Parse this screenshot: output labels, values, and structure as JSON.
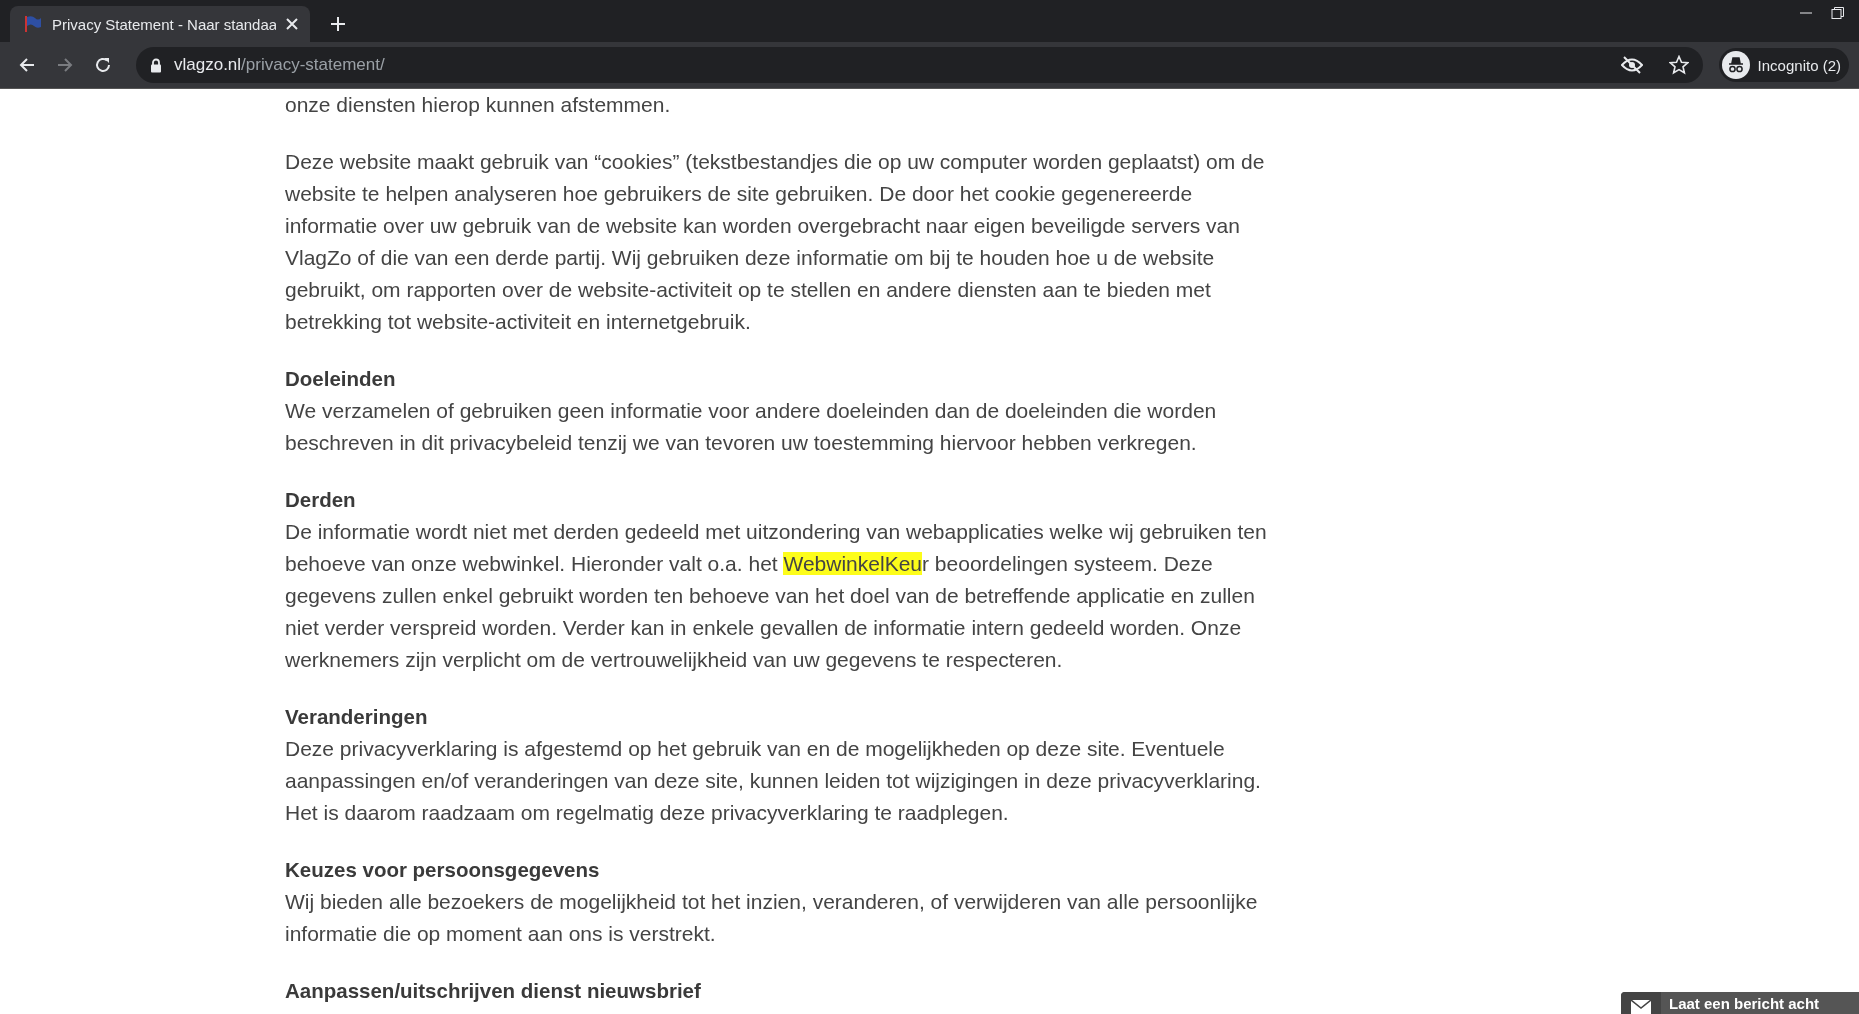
{
  "browser": {
    "tab": {
      "title": "Privacy Statement - Naar standaa"
    },
    "url": {
      "domain": "vlagzo.nl",
      "path": "/privacy-statement/"
    },
    "back_enabled": true,
    "forward_enabled": false,
    "profile": "Incognito (2)"
  },
  "article": {
    "blocks": [
      {
        "kind": "paragraph",
        "parts": [
          {
            "text": "onze diensten hierop kunnen afstemmen.",
            "highlight": false
          }
        ]
      },
      {
        "kind": "paragraph",
        "parts": [
          {
            "text": "Deze website maakt gebruik van “cookies” (tekstbestandjes die op uw computer worden geplaatst) om de website te helpen analyseren hoe gebruikers de site gebruiken. De door het cookie gegenereerde informatie over uw gebruik van de website kan worden overgebracht naar eigen beveiligde servers van VlagZo of die van een derde partij. Wij gebruiken deze informatie om bij te houden hoe u de website gebruikt, om rapporten over de website-activiteit op te stellen en andere diensten aan te bieden met betrekking tot website-activiteit en internetgebruik.",
            "highlight": false
          }
        ]
      },
      {
        "kind": "heading",
        "text": "Doeleinden"
      },
      {
        "kind": "paragraph",
        "parts": [
          {
            "text": "We verzamelen of gebruiken geen informatie voor andere doeleinden dan de doeleinden die worden beschreven in dit privacybeleid tenzij we van tevoren uw toestemming hiervoor hebben verkregen.",
            "highlight": false
          }
        ]
      },
      {
        "kind": "heading",
        "text": "Derden"
      },
      {
        "kind": "paragraph",
        "parts": [
          {
            "text": "De informatie wordt niet met derden gedeeld met uitzondering van webapplicaties welke wij gebruiken ten behoeve van onze webwinkel. Hieronder valt o.a. het ",
            "highlight": false
          },
          {
            "text": "WebwinkelKeu",
            "highlight": true
          },
          {
            "text": "r beoordelingen systeem. Deze gegevens zullen enkel gebruikt worden ten behoeve van het doel van de betreffende applicatie en zullen niet verder verspreid worden. Verder kan in enkele gevallen de informatie intern gedeeld worden. Onze werknemers zijn verplicht om de vertrouwelijkheid van uw gegevens te respecteren.",
            "highlight": false
          }
        ]
      },
      {
        "kind": "heading",
        "text": "Veranderingen"
      },
      {
        "kind": "paragraph",
        "parts": [
          {
            "text": "Deze privacyverklaring is afgestemd op het gebruik van en de mogelijkheden op deze site. Eventuele aanpassingen en/of veranderingen van deze site, kunnen leiden tot wijzigingen in deze privacyverklaring. Het is daarom raadzaam om regelmatig deze privacyverklaring te raadplegen.",
            "highlight": false
          }
        ]
      },
      {
        "kind": "heading",
        "text": "Keuzes voor persoonsgegevens"
      },
      {
        "kind": "paragraph",
        "parts": [
          {
            "text": "Wij bieden alle bezoekers de mogelijkheid tot het inzien, veranderen, of verwijderen van alle persoonlijke informatie die op moment aan ons is verstrekt.",
            "highlight": false
          }
        ]
      },
      {
        "kind": "heading",
        "text": "Aanpassen/uitschrijven dienst nieuwsbrief"
      }
    ]
  },
  "chat_widget": {
    "label": "Laat een bericht acht"
  }
}
